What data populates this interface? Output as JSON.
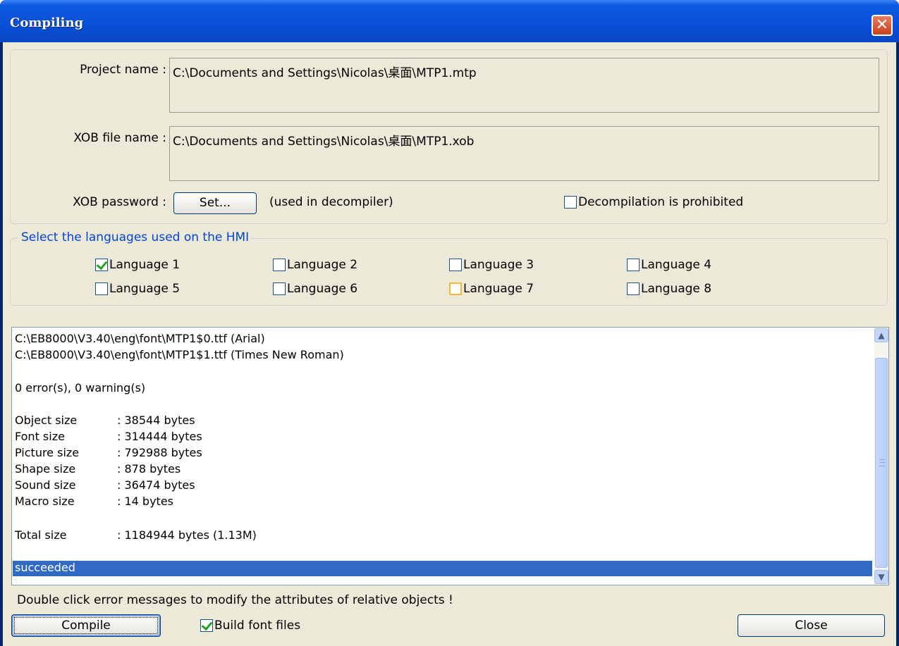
{
  "window": {
    "title": "Compiling",
    "close_glyph": "✕"
  },
  "project": {
    "project_label": "Project name :",
    "project_value": "C:\\Documents and Settings\\Nicolas\\桌面\\MTP1.mtp",
    "xob_label": "XOB file name :",
    "xob_value": "C:\\Documents and Settings\\Nicolas\\桌面\\MTP1.xob",
    "password_label": "XOB password :",
    "set_button": "Set...",
    "password_hint": "(used in decompiler)",
    "decompile_label": "Decompilation is prohibited",
    "decompile_checked": false
  },
  "languages": {
    "legend": "Select the languages used on the HMI",
    "items": [
      {
        "label": "Language 1",
        "checked": true
      },
      {
        "label": "Language 2",
        "checked": false
      },
      {
        "label": "Language 3",
        "checked": false
      },
      {
        "label": "Language 4",
        "checked": false
      },
      {
        "label": "Language 5",
        "checked": false
      },
      {
        "label": "Language 6",
        "checked": false
      },
      {
        "label": "Language 7",
        "checked": false
      },
      {
        "label": "Language 8",
        "checked": false
      }
    ]
  },
  "log": {
    "font_files": [
      "C:\\EB8000\\V3.40\\eng\\font\\MTP1$0.ttf (Arial)",
      "C:\\EB8000\\V3.40\\eng\\font\\MTP1$1.ttf (Times New Roman)"
    ],
    "summary": "0 error(s), 0 warning(s)",
    "sizes": [
      {
        "key": "Object size",
        "value": ": 38544 bytes"
      },
      {
        "key": "Font size",
        "value": ": 314444 bytes"
      },
      {
        "key": "Picture size",
        "value": ": 792988 bytes"
      },
      {
        "key": "Shape size",
        "value": ": 878 bytes"
      },
      {
        "key": "Sound size",
        "value": ": 36474 bytes"
      },
      {
        "key": "Macro size",
        "value": ": 14 bytes"
      }
    ],
    "total": {
      "key": "Total size",
      "value": ": 1184944 bytes (1.13M)"
    },
    "status": "succeeded"
  },
  "hint": "Double click  error messages  to modify the attributes of  relative objects !",
  "footer": {
    "compile_button": "Compile",
    "build_fonts_label": "Build font files",
    "build_fonts_checked": true,
    "close_button": "Close"
  },
  "colors": {
    "accent": "#0046d5",
    "selection": "#316ac5",
    "face": "#ece9d8",
    "title_bar": "#0a50d8"
  }
}
